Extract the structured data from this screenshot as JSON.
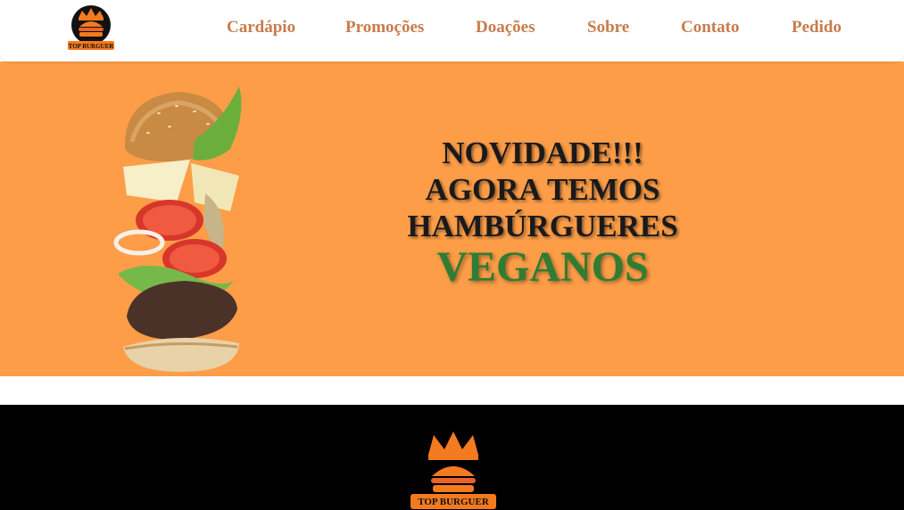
{
  "header": {
    "logo_label": "TOP BURGUER",
    "nav": [
      "Cardápio",
      "Promoções",
      "Doações",
      "Sobre",
      "Contato",
      "Pedido"
    ]
  },
  "hero": {
    "line1": "NOVIDADE!!!",
    "line2": "AGORA TEMOS",
    "line3": "HAMBÚRGUERES",
    "line4": "VEGANOS"
  },
  "footer": {
    "logo_label": "TOP BURGUER"
  },
  "colors": {
    "hero_bg": "#fd9d48",
    "nav_text": "#c77c4c",
    "vegan_green": "#2e7d32",
    "footer_bg": "#000000"
  }
}
